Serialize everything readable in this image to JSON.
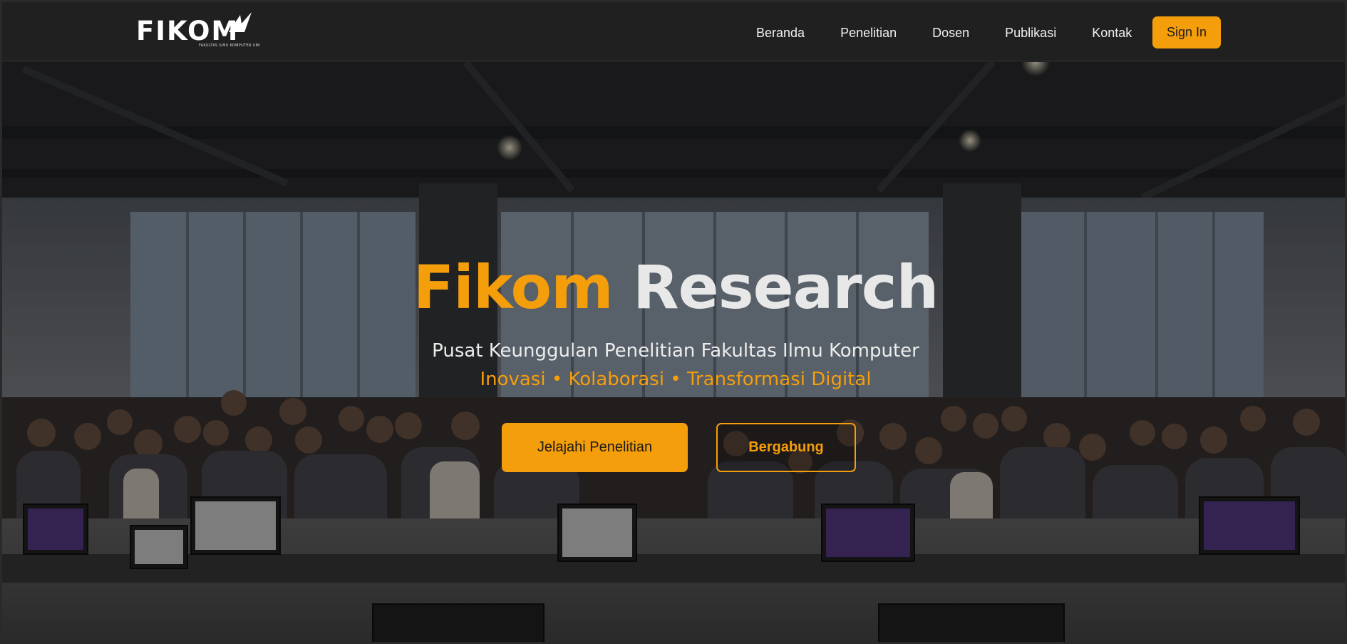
{
  "header": {
    "logo_text": "FIKOM",
    "logo_tagline": "FAKULTAS ILMU KOMPUTER UMI",
    "nav": [
      {
        "label": "Beranda"
      },
      {
        "label": "Penelitian"
      },
      {
        "label": "Dosen"
      },
      {
        "label": "Publikasi"
      },
      {
        "label": "Kontak"
      }
    ],
    "signin_label": "Sign In"
  },
  "hero": {
    "title_accent": "Fikom",
    "title_rest": "Research",
    "subtitle": "Pusat Keunggulan Penelitian Fakultas Ilmu Komputer",
    "tagline": "Inovasi • Kolaborasi • Transformasi Digital",
    "primary_button": "Jelajahi Penelitian",
    "secondary_button": "Bergabung",
    "background_image": "group photo of students in a computer lab"
  },
  "colors": {
    "accent": "#f59e0b",
    "navbar_bg": "#202020",
    "text_light": "#ececec"
  }
}
